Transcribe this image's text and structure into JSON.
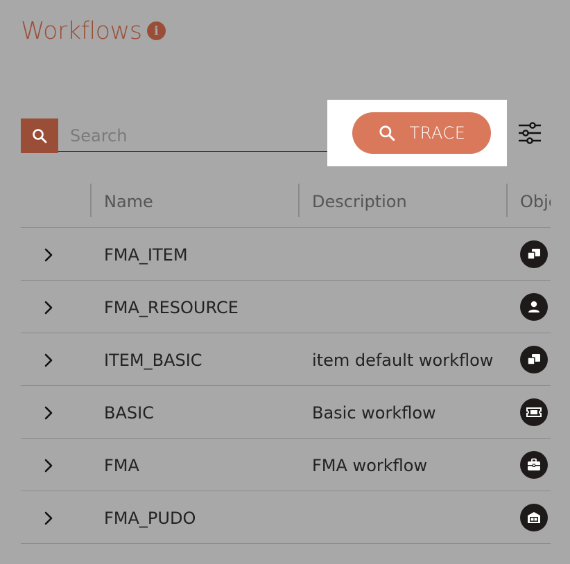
{
  "header": {
    "title": "Workflows"
  },
  "toolbar": {
    "search_placeholder": "Search",
    "search_value": "",
    "trace_label": "TRACE"
  },
  "table": {
    "columns": [
      "Name",
      "Description",
      "Obje"
    ],
    "rows": [
      {
        "name": "FMA_ITEM",
        "description": "",
        "object_icon": "item-icon"
      },
      {
        "name": "FMA_RESOURCE",
        "description": "",
        "object_icon": "person-icon"
      },
      {
        "name": "ITEM_BASIC",
        "description": "item default workflow",
        "object_icon": "item-icon"
      },
      {
        "name": "BASIC",
        "description": "Basic workflow",
        "object_icon": "ticket-icon"
      },
      {
        "name": "FMA",
        "description": "FMA workflow",
        "object_icon": "briefcase-icon"
      },
      {
        "name": "FMA_PUDO",
        "description": "",
        "object_icon": "storefront-icon"
      }
    ]
  },
  "colors": {
    "background": "#a8a8a8",
    "title": "#9a4e37",
    "accent_button": "#d9785b",
    "search_button": "#9a4e37",
    "icon_circle": "#1e1a1a"
  }
}
